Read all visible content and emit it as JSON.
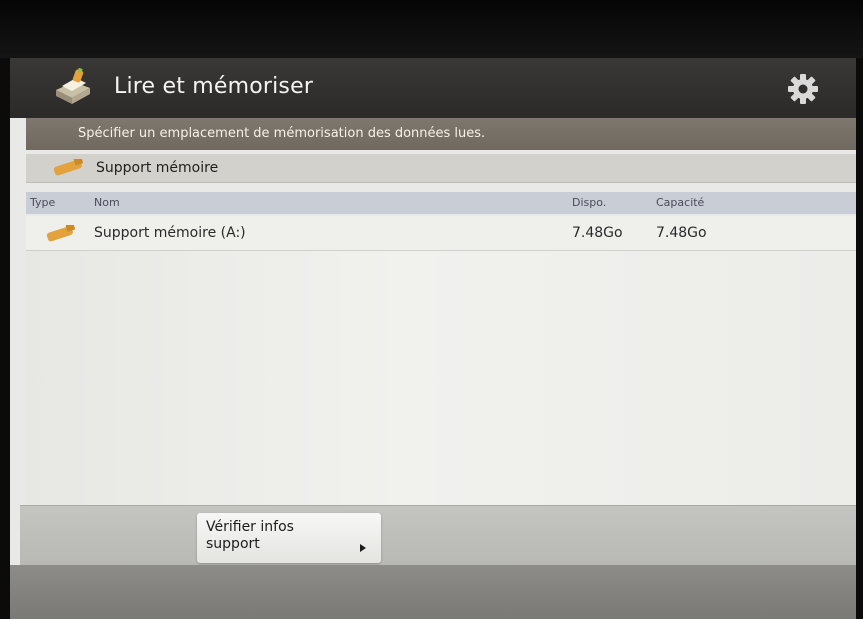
{
  "header": {
    "title": "Lire et mémoriser",
    "icon": "scan-and-store-icon",
    "settings_icon": "gear-icon"
  },
  "instruction": "Spécifier un emplacement de mémorisation des données lues.",
  "section": {
    "label": "Support mémoire",
    "icon": "usb-stick-icon"
  },
  "table": {
    "columns": {
      "type": "Type",
      "name": "Nom",
      "available": "Dispo.",
      "capacity": "Capacité"
    },
    "rows": [
      {
        "icon": "usb-stick-icon",
        "name": "Support mémoire (A:)",
        "available": "7.48Go",
        "capacity": "7.48Go"
      }
    ]
  },
  "footer": {
    "check_media_button": "Vérifier infos support"
  },
  "colors": {
    "header_bg": "#2f2e2c",
    "instruction_bg": "#756f65",
    "section_bg": "#d2d1cc",
    "column_header_bg": "#c9cdd6",
    "stick_orange": "#e3a23b"
  }
}
